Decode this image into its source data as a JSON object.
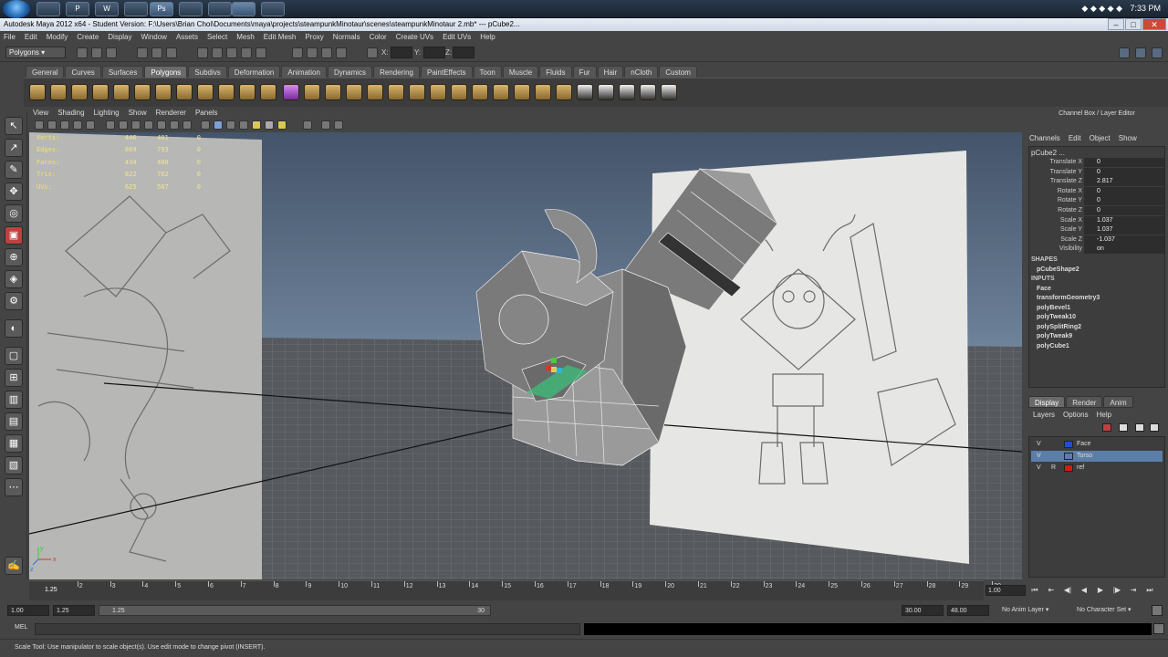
{
  "taskbar": {
    "apps": [
      "",
      "P",
      "W",
      "",
      "Ps",
      "",
      "",
      "",
      "",
      ""
    ],
    "clock": "7:33 PM"
  },
  "window": {
    "title": "Autodesk Maya 2012 x64 - Student Version: F:\\Users\\Brian Choi\\Documents\\maya\\projects\\steampunkMinotaur\\scenes\\steampunkMinotaur 2.mb*  ---  pCube2..."
  },
  "menubar": [
    "File",
    "Edit",
    "Modify",
    "Create",
    "Display",
    "Window",
    "Assets",
    "Select",
    "Mesh",
    "Edit Mesh",
    "Proxy",
    "Normals",
    "Color",
    "Create UVs",
    "Edit UVs",
    "Help"
  ],
  "statusline": {
    "mode": "Polygons",
    "x_label": "X:",
    "y_label": "Y:",
    "z_label": "Z:"
  },
  "shelf": {
    "tabs": [
      "General",
      "Curves",
      "Surfaces",
      "Polygons",
      "Subdivs",
      "Deformation",
      "Animation",
      "Dynamics",
      "Rendering",
      "PaintEffects",
      "Toon",
      "Muscle",
      "Fluids",
      "Fur",
      "Hair",
      "nCloth",
      "Custom"
    ],
    "active_tab": "Polygons"
  },
  "panel": {
    "menu": [
      "View",
      "Shading",
      "Lighting",
      "Show",
      "Renderer",
      "Panels"
    ]
  },
  "hud": {
    "rows": [
      {
        "label": "Verts:",
        "a": "446",
        "b": "401",
        "c": "0"
      },
      {
        "label": "Edges:",
        "a": "869",
        "b": "793",
        "c": "0"
      },
      {
        "label": "Faces:",
        "a": "434",
        "b": "400",
        "c": "0"
      },
      {
        "label": "Tris:",
        "a": "822",
        "b": "762",
        "c": "0"
      },
      {
        "label": "UVs:",
        "a": "625",
        "b": "567",
        "c": "0"
      }
    ],
    "axis_x": "x",
    "axis_y": "y",
    "axis_z": "z"
  },
  "channelbox": {
    "header": "Channel Box / Layer Editor",
    "menu": [
      "Channels",
      "Edit",
      "Object",
      "Show"
    ],
    "object": "pCube2 ...",
    "channels": [
      {
        "name": "Translate X",
        "value": "0"
      },
      {
        "name": "Translate Y",
        "value": "0"
      },
      {
        "name": "Translate Z",
        "value": "2.817"
      },
      {
        "name": "Rotate X",
        "value": "0"
      },
      {
        "name": "Rotate Y",
        "value": "0"
      },
      {
        "name": "Rotate Z",
        "value": "0"
      },
      {
        "name": "Scale X",
        "value": "1.037"
      },
      {
        "name": "Scale Y",
        "value": "1.037"
      },
      {
        "name": "Scale Z",
        "value": "-1.037"
      },
      {
        "name": "Visibility",
        "value": "on"
      }
    ],
    "shapes_label": "SHAPES",
    "shape": "pCubeShape2",
    "inputs_label": "INPUTS",
    "inputs": [
      "Face",
      "transformGeometry3",
      "polyBevel1",
      "polyTweak10",
      "polySplitRing2",
      "polyTweak9",
      "polyCube1"
    ]
  },
  "layereditor": {
    "tabs": [
      "Display",
      "Render",
      "Anim"
    ],
    "active_tab": "Display",
    "menu": [
      "Layers",
      "Options",
      "Help"
    ],
    "layers": [
      {
        "v": "V",
        "r": "",
        "name": "Face",
        "color": "#1e4fd0",
        "selected": false
      },
      {
        "v": "V",
        "r": "",
        "name": "Torso",
        "color": "#5b7ea8",
        "selected": true
      },
      {
        "v": "V",
        "r": "R",
        "name": "ref",
        "color": "#e01515",
        "selected": false
      }
    ]
  },
  "timeline": {
    "ticks": [
      "2",
      "3",
      "4",
      "5",
      "6",
      "7",
      "8",
      "9",
      "10",
      "11",
      "12",
      "13",
      "14",
      "15",
      "16",
      "17",
      "18",
      "19",
      "20",
      "21",
      "22",
      "23",
      "24",
      "25",
      "26",
      "27",
      "28",
      "29",
      "30"
    ],
    "current_frame": "1.25",
    "current_field": "1.00"
  },
  "range": {
    "start": "1.00",
    "anim_start": "1.25",
    "range_start": "1.25",
    "range_end": "30",
    "end": "30.00",
    "anim_end": "48.00",
    "anim_layer": "No Anim Layer",
    "character_set": "No Character Set"
  },
  "commandline": {
    "label": "MEL"
  },
  "helpline": "Scale Tool: Use manipulator to scale object(s). Use edit mode to change pivot (INSERT)."
}
